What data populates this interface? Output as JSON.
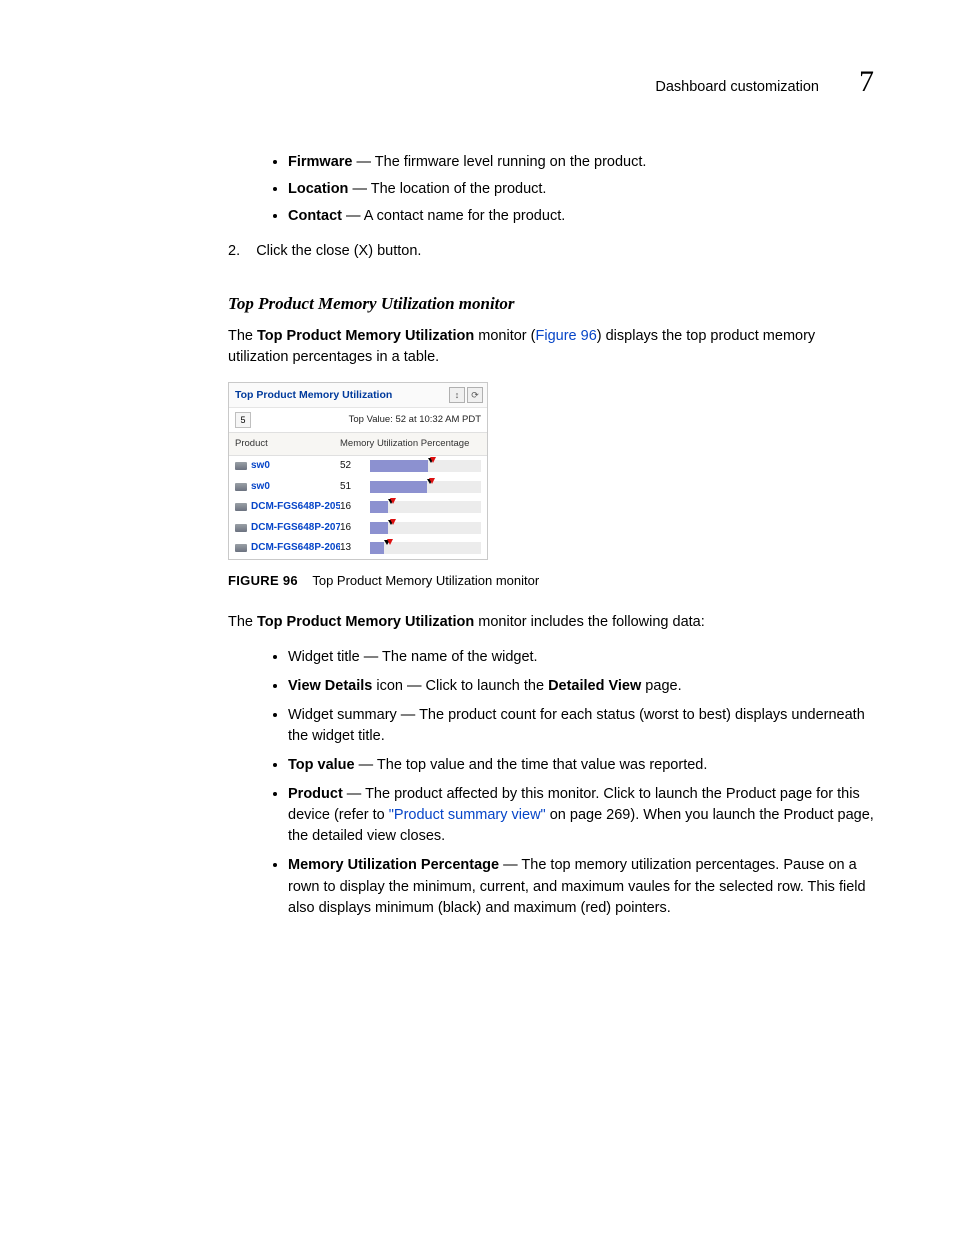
{
  "header": {
    "title": "Dashboard customization",
    "chapter": "7"
  },
  "intro_bullets": [
    {
      "term": "Firmware",
      "desc": " — The firmware level running on the product."
    },
    {
      "term": "Location",
      "desc": " — The location of the product."
    },
    {
      "term": "Contact",
      "desc": " — A contact name for the product."
    }
  ],
  "step2": "2.    Click the close (X) button.",
  "section_heading": "Top Product Memory Utilization monitor",
  "para1_pre": "The ",
  "para1_bold": "Top Product Memory Utilization",
  "para1_mid": " monitor (",
  "para1_link": "Figure 96",
  "para1_post": ") displays the top product memory utilization percentages in a table.",
  "figure": {
    "label": "FIGURE 96",
    "caption": "Top Product Memory Utilization monitor"
  },
  "para2_pre": "The ",
  "para2_bold": "Top Product Memory Utilization",
  "para2_post": " monitor includes the following data:",
  "data_bullets": {
    "b1": "Widget title — The name of the widget.",
    "b2_term": "View Details",
    "b2_mid": " icon — Click to launch the ",
    "b2_bold2": "Detailed View",
    "b2_end": " page.",
    "b3": "Widget summary — The product count for each status (worst to best) displays underneath the widget title.",
    "b4_term": "Top value",
    "b4_rest": " — The top value and the time that value was reported.",
    "b5_term": "Product",
    "b5_mid": " — The product affected by this monitor. Click to launch the Product page for this device (refer to ",
    "b5_link": "\"Product summary view\"",
    "b5_end": " on page 269). When you launch the Product page, the detailed view closes.",
    "b6_term": "Memory Utilization Percentage",
    "b6_rest": " — The top memory utilization percentages. Pause on a rown to display the minimum, current, and maximum vaules for the selected row. This field also displays minimum (black) and maximum (red) pointers."
  },
  "widget": {
    "title": "Top Product Memory Utilization",
    "count": "5",
    "topvalue": "Top Value: 52 at 10:32 AM PDT",
    "col_product": "Product",
    "col_mem": "Memory Utilization Percentage",
    "rows": [
      {
        "name": "sw0",
        "val": "52",
        "pct": 52,
        "max": 54
      },
      {
        "name": "sw0",
        "val": "51",
        "pct": 51,
        "max": 53
      },
      {
        "name": "DCM-FGS648P-205",
        "val": "16",
        "pct": 16,
        "max": 18
      },
      {
        "name": "DCM-FGS648P-207",
        "val": "16",
        "pct": 16,
        "max": 18
      },
      {
        "name": "DCM-FGS648P-206",
        "val": "13",
        "pct": 13,
        "max": 15
      }
    ]
  }
}
